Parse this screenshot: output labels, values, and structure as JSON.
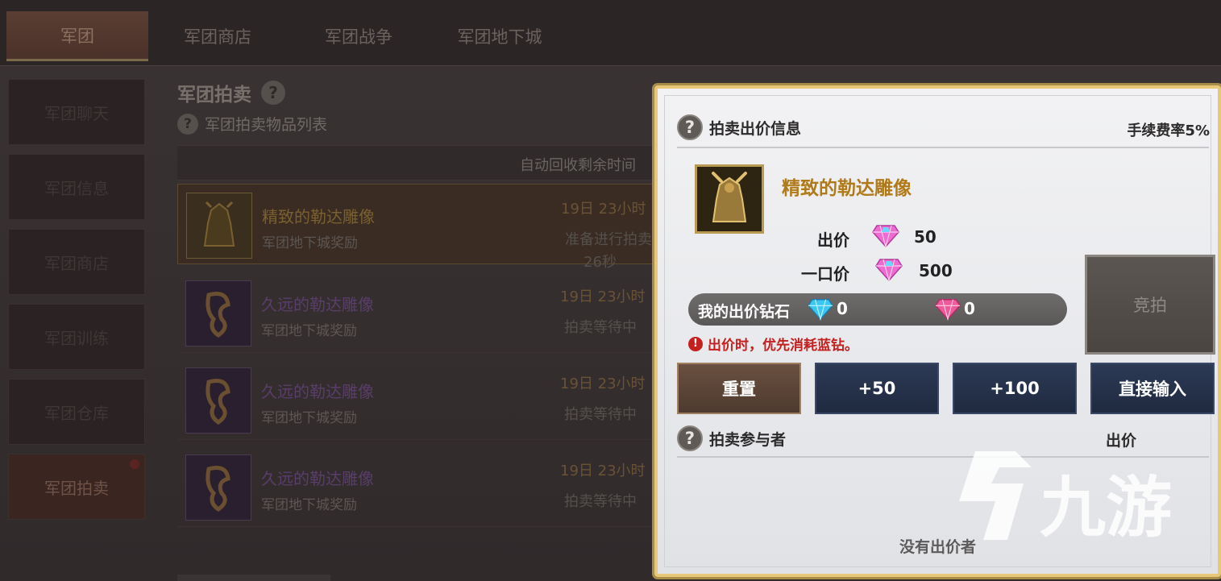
{
  "main_tabs": [
    {
      "label": "军团"
    },
    {
      "label": "军团商店"
    },
    {
      "label": "军团战争"
    },
    {
      "label": "军团地下城"
    }
  ],
  "sidebar": {
    "items": [
      {
        "label": "军团聊天"
      },
      {
        "label": "军团信息"
      },
      {
        "label": "军团商店"
      },
      {
        "label": "军团训练"
      },
      {
        "label": "军团仓库"
      },
      {
        "label": "军团拍卖"
      }
    ]
  },
  "auction": {
    "title": "军团拍卖",
    "list_title": "军团拍卖物品列表",
    "header_time": "自动回收剩余时间",
    "rows": [
      {
        "name": "精致的勒达雕像",
        "sub": "军团地下城奖励",
        "time": "19日 23小时",
        "status": "准备进行拍卖",
        "extra": "26秒"
      },
      {
        "name": "久远的勒达雕像",
        "sub": "军团地下城奖励",
        "time": "19日 23小时",
        "status": "拍卖等待中"
      },
      {
        "name": "久远的勒达雕像",
        "sub": "军团地下城奖励",
        "time": "19日 23小时",
        "status": "拍卖等待中"
      },
      {
        "name": "久远的勒达雕像",
        "sub": "军团地下城奖励",
        "time": "19日 23小时",
        "status": "拍卖等待中"
      }
    ]
  },
  "modal": {
    "bid_info_title": "拍卖出价信息",
    "fee_rate": "手续费率5%",
    "item_name": "精致的勒达雕像",
    "bid_label": "出价",
    "bid_value": "50",
    "buyout_label": "一口价",
    "buyout_value": "500",
    "my_bid_label": "我的出价钻石",
    "my_blue_diamond": "0",
    "my_pink_diamond": "0",
    "warning": "出价时，优先消耗蓝钻。",
    "bid_button": "竞拍",
    "buttons": {
      "reset": "重置",
      "plus50": "+50",
      "plus100": "+100",
      "direct_input": "直接输入"
    },
    "participants_title": "拍卖参与者",
    "participants_col_bid": "出价",
    "empty_text": "没有出价者"
  },
  "watermark": {
    "text": "九游"
  },
  "colors": {
    "modal_border": "#e8c878",
    "item_name": "#b07a1a",
    "warning": "#c42020",
    "button_blue": "#1f2a40"
  }
}
